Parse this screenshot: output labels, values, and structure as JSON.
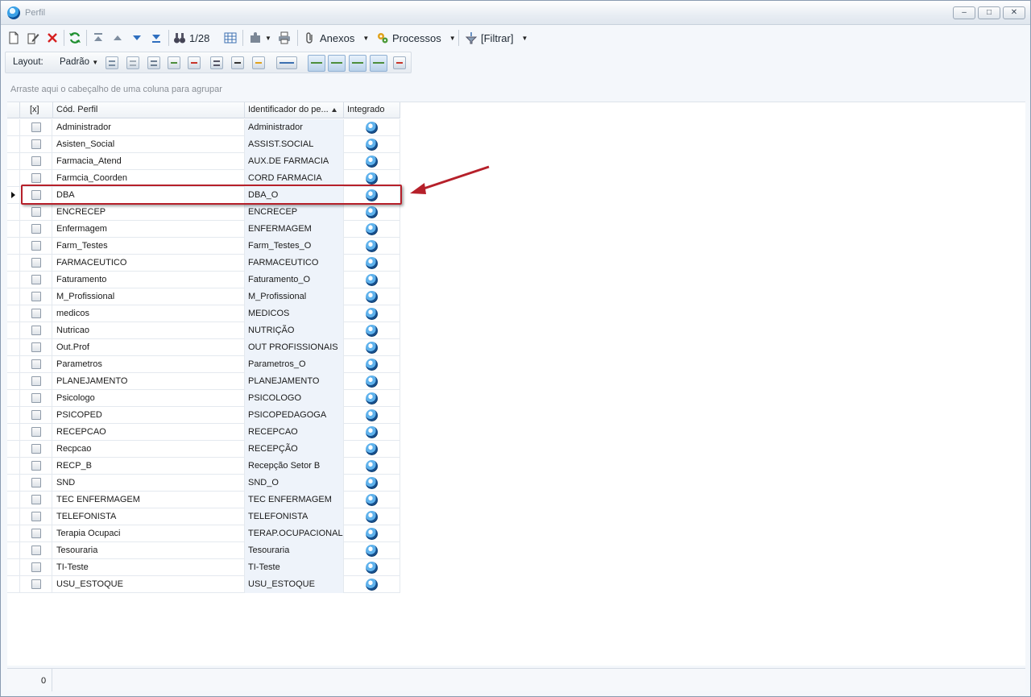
{
  "window": {
    "title": "Perfil",
    "buttons": [
      "–",
      "□",
      "✕"
    ]
  },
  "toolbar": {
    "record_counter": "1/28",
    "anexos_label": "Anexos",
    "processos_label": "Processos",
    "filtrar_label": "[Filtrar]"
  },
  "layout_bar": {
    "layout_label": "Layout:",
    "preset_label": "Padrão"
  },
  "group_hint": "Arraste aqui o cabeçalho de uma coluna para agrupar",
  "grid": {
    "columns": {
      "select": "[x]",
      "code": "Cód. Perfil",
      "identifier": "Identificador do pe...",
      "integrated": "Integrado"
    },
    "rows": [
      {
        "code": "Administrador",
        "identifier": "Administrador"
      },
      {
        "code": "Asisten_Social",
        "identifier": "ASSIST.SOCIAL"
      },
      {
        "code": "Farmacia_Atend",
        "identifier": "AUX.DE FARMACIA"
      },
      {
        "code": "Farmcia_Coorden",
        "identifier": "CORD FARMACIA"
      },
      {
        "code": "DBA",
        "identifier": "DBA_O"
      },
      {
        "code": "ENCRECEP",
        "identifier": "ENCRECEP"
      },
      {
        "code": "Enfermagem",
        "identifier": "ENFERMAGEM"
      },
      {
        "code": "Farm_Testes",
        "identifier": "Farm_Testes_O"
      },
      {
        "code": "FARMACEUTICO",
        "identifier": "FARMACEUTICO"
      },
      {
        "code": "Faturamento",
        "identifier": "Faturamento_O"
      },
      {
        "code": "M_Profissional",
        "identifier": "M_Profissional"
      },
      {
        "code": "medicos",
        "identifier": "MEDICOS"
      },
      {
        "code": "Nutricao",
        "identifier": "NUTRIÇÃO"
      },
      {
        "code": "Out.Prof",
        "identifier": "OUT PROFISSIONAIS"
      },
      {
        "code": "Parametros",
        "identifier": "Parametros_O"
      },
      {
        "code": "PLANEJAMENTO",
        "identifier": "PLANEJAMENTO"
      },
      {
        "code": "Psicologo",
        "identifier": "PSICOLOGO"
      },
      {
        "code": "PSICOPED",
        "identifier": "PSICOPEDAGOGA"
      },
      {
        "code": "RECEPCAO",
        "identifier": "RECEPCAO"
      },
      {
        "code": "Recpcao",
        "identifier": "RECEPÇÃO"
      },
      {
        "code": "RECP_B",
        "identifier": "Recepção Setor B"
      },
      {
        "code": "SND",
        "identifier": "SND_O"
      },
      {
        "code": "TEC ENFERMAGEM",
        "identifier": "TEC ENFERMAGEM"
      },
      {
        "code": "TELEFONISTA",
        "identifier": "TELEFONISTA"
      },
      {
        "code": "Terapia Ocupaci",
        "identifier": "TERAP.OCUPACIONAL"
      },
      {
        "code": "Tesouraria",
        "identifier": "Tesouraria"
      },
      {
        "code": "TI-Teste",
        "identifier": "TI-Teste"
      },
      {
        "code": "USU_ESTOQUE",
        "identifier": "USU_ESTOQUE"
      }
    ],
    "current_row": "DBA"
  },
  "footer": {
    "selected_count": "0"
  },
  "colors": {
    "highlight_border": "#b6202a",
    "sorted_column_bg": "#eef3fa"
  }
}
